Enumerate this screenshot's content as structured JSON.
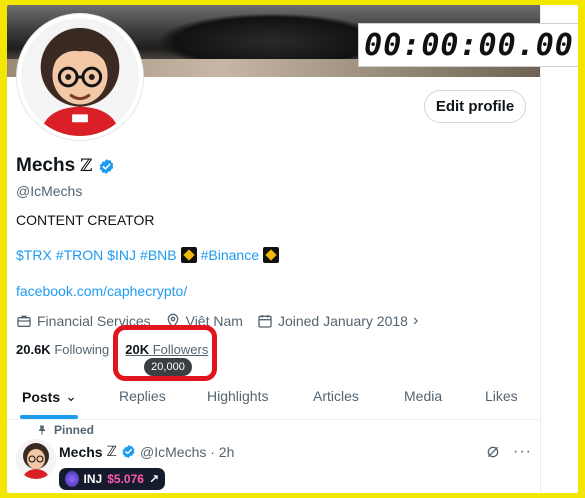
{
  "timer": {
    "display": "00:00:00.00"
  },
  "profile": {
    "edit_label": "Edit profile",
    "name": "Mechs",
    "name_suffix": "ℤ",
    "handle": "@IcMechs",
    "bio": "CONTENT CREATOR",
    "tags": [
      "$TRX",
      "#TRON",
      "$INJ",
      "#BNB",
      "#Binance"
    ],
    "link": "facebook.com/caphecrypto/",
    "meta": {
      "category": "Financial Services",
      "location": "Việt Nam",
      "joined": "Joined January 2018"
    },
    "following_count": "20.6K",
    "following_label": "Following",
    "followers_count": "20K",
    "followers_label": "Followers",
    "followers_tooltip": "20,000"
  },
  "tabs": [
    {
      "label": "Posts",
      "active": true
    },
    {
      "label": "Replies"
    },
    {
      "label": "Highlights"
    },
    {
      "label": "Articles"
    },
    {
      "label": "Media"
    },
    {
      "label": "Likes"
    }
  ],
  "post": {
    "pinned_label": "Pinned",
    "name": "Mechs",
    "name_suffix": "ℤ",
    "handle_time": "@IcMechs · 2h",
    "ticker": {
      "symbol": "INJ",
      "price": "$5.076"
    }
  },
  "colors": {
    "accent": "#1d9bf0",
    "frame": "#f3e600",
    "highlight": "#e2141d"
  }
}
